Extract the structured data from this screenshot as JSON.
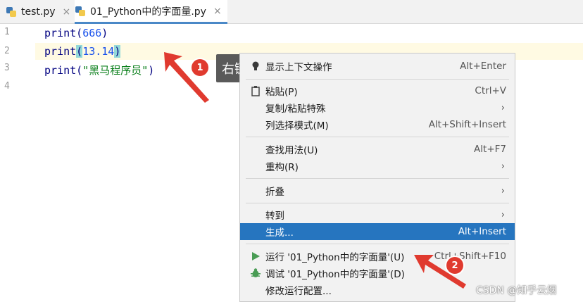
{
  "tabs": [
    {
      "label": "test.py",
      "close": "×"
    },
    {
      "label": "01_Python中的字面量.py",
      "close": "×"
    }
  ],
  "gutter": {
    "lines": [
      "1",
      "2",
      "3",
      "4"
    ]
  },
  "code": {
    "line1": {
      "fn": "print(",
      "arg": "666",
      "end": ")"
    },
    "line2": {
      "fn": "print",
      "open": "(",
      "arg": "13.14",
      "close": ")"
    },
    "line3": {
      "fn": "print(",
      "arg": "\"黑马程序员\"",
      "end": ")"
    }
  },
  "annotations": {
    "badge1": "1",
    "badge2": "2",
    "tooltip": "右键",
    "color": "#e03a2f"
  },
  "menu": {
    "items": [
      {
        "label": "显示上下文操作",
        "shortcut": "Alt+Enter",
        "icon": "lightbulb-icon"
      },
      {
        "label": "粘贴(P)",
        "shortcut": "Ctrl+V",
        "icon": "clipboard-icon"
      },
      {
        "label": "复制/粘贴特殊",
        "submenu": "›"
      },
      {
        "label": "列选择模式(M)",
        "shortcut": "Alt+Shift+Insert"
      },
      {
        "label": "查找用法(U)",
        "shortcut": "Alt+F7"
      },
      {
        "label": "重构(R)",
        "submenu": "›"
      },
      {
        "label": "折叠",
        "submenu": "›"
      },
      {
        "label": "转到",
        "submenu": "›"
      },
      {
        "label": "生成...",
        "shortcut": "Alt+Insert",
        "selected": true
      },
      {
        "label": "运行 '01_Python中的字面量'(U)",
        "shortcut": "Ctrl+Shift+F10",
        "icon": "run-icon"
      },
      {
        "label": "调试 '01_Python中的字面量'(D)",
        "icon": "debug-icon"
      },
      {
        "label": "修改运行配置..."
      }
    ]
  },
  "colors": {
    "accent": "#2675bf",
    "run": "#499c54",
    "selection": "#2675bf"
  },
  "watermark": "CSDN @知乎云烟"
}
